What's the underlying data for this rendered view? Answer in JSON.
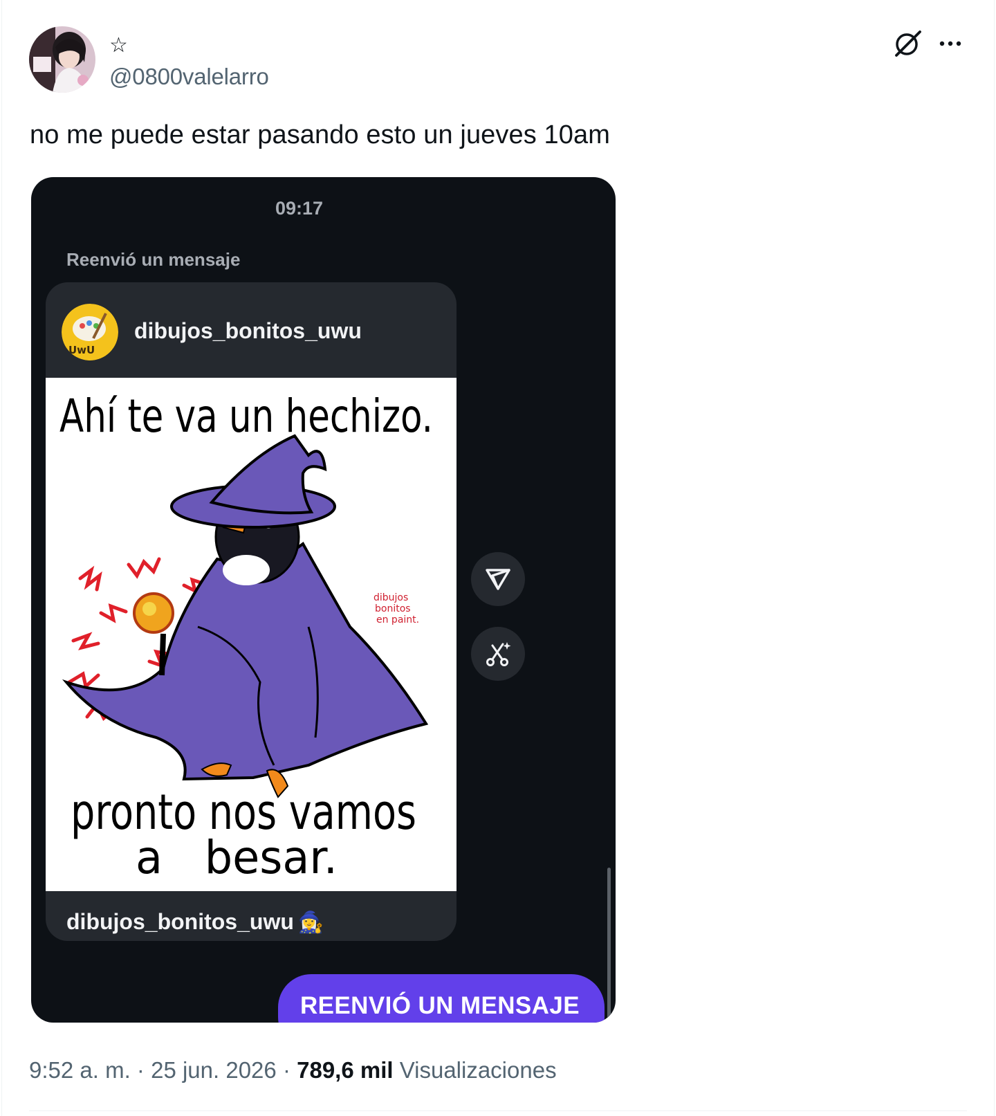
{
  "author": {
    "display_name": "☆",
    "handle": "@0800valelarro"
  },
  "tweet": {
    "text": "no me puede estar pasando esto un jueves 10am"
  },
  "media": {
    "time": "09:17",
    "forward_label": "Reenvió un mensaje",
    "card": {
      "username": "dibujos_bonitos_uwu",
      "avatar_text": "UwU",
      "image_top_text": "Ahí te va un hechizo.",
      "image_bottom_text_line1": "pronto nos vamos",
      "image_bottom_text_line2": "a   besar.",
      "watermark": [
        "dibujos",
        "bonitos",
        "en paint."
      ],
      "caption_user": "dibujos_bonitos_uwu",
      "caption_emoji": "🧙‍♀️"
    },
    "reply_bubble": "REENVIÓ UN MENSAJE",
    "icons": [
      "share-icon",
      "remix-icon"
    ]
  },
  "meta": {
    "time": "9:52 a. m.",
    "separator": "·",
    "date": "25 jun. 2026",
    "views_count": "789,6 mil",
    "views_label": "Visualizaciones"
  },
  "colors": {
    "text_primary": "#0f1419",
    "text_secondary": "#536471",
    "media_background": "#0d1116",
    "card_background": "#25292f",
    "bubble_purple": "#6240ea",
    "robe_purple": "#6a58b8"
  }
}
